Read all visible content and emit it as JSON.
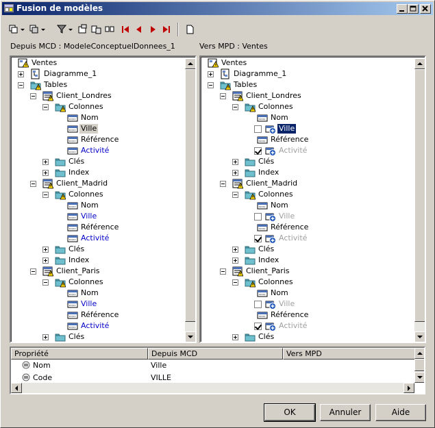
{
  "window": {
    "title": "Fusion de modèles",
    "controls": [
      "minimize-icon",
      "maximize-icon",
      "close-icon"
    ]
  },
  "toolbar": {
    "buttons": [
      "select-all-dropdown-icon",
      "deselect-dropdown-icon",
      "filter-dropdown-icon",
      "properties-icon",
      "compare-icon",
      "split-view-icon",
      "first-icon",
      "previous-icon",
      "next-icon",
      "last-icon",
      "new-page-icon"
    ]
  },
  "left_pane": {
    "label": "Depuis MCD : ModeleConceptuelDonnees_1"
  },
  "right_pane": {
    "label": "Vers MPD : Ventes"
  },
  "tree_labels": {
    "root": "Ventes",
    "diagram": "Diagramme_1",
    "tables": "Tables",
    "columns": "Colonnes",
    "keys": "Clés",
    "indexes": "Index",
    "col_nom": "Nom",
    "col_ville": "Ville",
    "col_reference": "Référence",
    "col_activite": "Activité",
    "client_londres": "Client_Londres",
    "client_madrid": "Client_Madrid",
    "client_paris": "Client_Paris"
  },
  "properties": {
    "headers": [
      "Propriété",
      "Depuis MCD",
      "Vers MPD"
    ],
    "rows": [
      {
        "property": "Nom",
        "from": "Ville",
        "to": ""
      },
      {
        "property": "Code",
        "from": "VILLE",
        "to": ""
      }
    ]
  },
  "buttons": {
    "ok": "OK",
    "cancel": "Annuler",
    "help": "Aide"
  },
  "colors": {
    "title_active": "#0a246a",
    "new_item_blue": "#0000cc",
    "disabled_gray": "#a0a0a0",
    "toolbar_red": "#c00000"
  }
}
